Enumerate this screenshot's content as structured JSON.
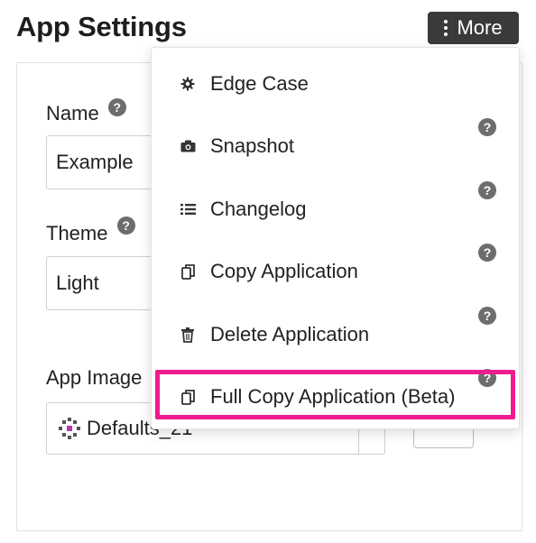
{
  "page": {
    "title": "App Settings"
  },
  "header": {
    "more_label": "More"
  },
  "form": {
    "name_label": "Name",
    "name_value": "Example",
    "theme_label": "Theme",
    "theme_value": "Light",
    "app_image_label": "App Image",
    "app_image_value": "Defaults_21"
  },
  "menu": {
    "items": [
      {
        "label": "Edge Case",
        "icon": "gear-icon",
        "help": false
      },
      {
        "label": "Snapshot",
        "icon": "camera-icon",
        "help": true
      },
      {
        "label": "Changelog",
        "icon": "list-icon",
        "help": true
      },
      {
        "label": "Copy Application",
        "icon": "copy-icon",
        "help": true
      },
      {
        "label": "Delete Application",
        "icon": "trash-icon",
        "help": true
      },
      {
        "label": "Full Copy Application (Beta)",
        "icon": "copy-icon",
        "help": true,
        "highlighted": true
      }
    ],
    "highlight_color": "#ee1c8f"
  },
  "help_glyph": "?"
}
